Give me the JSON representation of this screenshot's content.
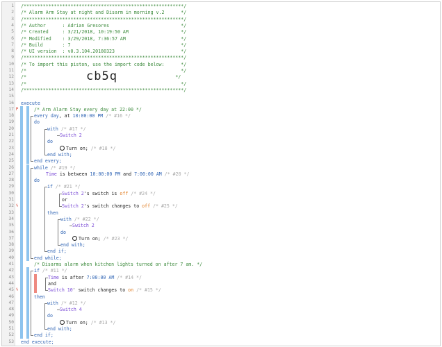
{
  "editor": {
    "lines": [
      {
        "n": "1",
        "segs": [
          {
            "c": "c",
            "t": "/**********************************************************/"
          }
        ]
      },
      {
        "n": "2",
        "segs": [
          {
            "c": "c",
            "t": "/* Alarm Arm Stay at night and Disarm in morning v.2      */"
          }
        ]
      },
      {
        "n": "3",
        "segs": [
          {
            "c": "c",
            "t": "/**********************************************************/"
          }
        ]
      },
      {
        "n": "4",
        "segs": [
          {
            "c": "c",
            "t": "/* Author      : Adrian Gresores                          */"
          }
        ]
      },
      {
        "n": "5",
        "segs": [
          {
            "c": "c",
            "t": "/* Created     : 3/21/2018, 10:19:50 AM                   */"
          }
        ]
      },
      {
        "n": "6",
        "segs": [
          {
            "c": "c",
            "t": "/* Modified    : 3/29/2018, 7:36:57 AM                    */"
          }
        ]
      },
      {
        "n": "7",
        "segs": [
          {
            "c": "c",
            "t": "/* Build       : 7                                        */"
          }
        ]
      },
      {
        "n": "8",
        "segs": [
          {
            "c": "c",
            "t": "/* UI version  : v0.3.104.20180323                        */"
          }
        ]
      },
      {
        "n": "9",
        "segs": [
          {
            "c": "c",
            "t": "/**********************************************************/"
          }
        ]
      },
      {
        "n": "10",
        "segs": [
          {
            "c": "c",
            "t": "/* To import this piston, use the import code below:      */"
          }
        ]
      },
      {
        "n": "11",
        "segs": [
          {
            "c": "c",
            "t": "/*                                                        */"
          }
        ]
      },
      {
        "n": "12",
        "segs": [
          {
            "c": "c",
            "t": "/*"
          },
          {
            "c": "c",
            "t": "                                                      */"
          }
        ]
      },
      {
        "n": "13",
        "segs": [
          {
            "c": "c",
            "t": "/*                                                        */"
          }
        ]
      },
      {
        "n": "14",
        "segs": [
          {
            "c": "c",
            "t": "/**********************************************************/"
          }
        ]
      },
      {
        "n": "15",
        "segs": []
      },
      {
        "n": "16",
        "segs": [
          {
            "c": "k",
            "t": "execute"
          }
        ]
      },
      {
        "n": "17",
        "segs": [
          {
            "c": "c",
            "t": "/* Arm Alarm Stay every day at 22:00 */"
          }
        ]
      },
      {
        "n": "18",
        "segs": [
          {
            "c": "k",
            "t": "every day"
          },
          {
            "c": "t",
            "t": ", at "
          },
          {
            "c": "k",
            "t": "10:00:00 PM"
          },
          {
            "c": "g",
            "t": " /* #16 */"
          }
        ]
      },
      {
        "n": "19",
        "segs": [
          {
            "c": "k",
            "t": "do"
          }
        ]
      },
      {
        "n": "20",
        "segs": [
          {
            "c": "k",
            "t": "with"
          },
          {
            "c": "g",
            "t": " /* #17 */"
          }
        ]
      },
      {
        "n": "21",
        "segs": [
          {
            "c": "d",
            "t": "Switch 2"
          }
        ]
      },
      {
        "n": "22",
        "segs": [
          {
            "c": "k",
            "t": "do"
          }
        ]
      },
      {
        "n": "23",
        "segs": [
          {
            "c": "t",
            "t": "Turn on;"
          },
          {
            "c": "g",
            "t": " /* #18 */"
          }
        ]
      },
      {
        "n": "24",
        "segs": [
          {
            "c": "k",
            "t": "end with;"
          }
        ]
      },
      {
        "n": "25",
        "segs": [
          {
            "c": "k",
            "t": "end every;"
          }
        ]
      },
      {
        "n": "26",
        "segs": [
          {
            "c": "k",
            "t": "while"
          },
          {
            "c": "g",
            "t": " /* #19 */"
          }
        ]
      },
      {
        "n": "27",
        "segs": [
          {
            "c": "d",
            "t": "Time"
          },
          {
            "c": "t",
            "t": " is between "
          },
          {
            "c": "k",
            "t": "10:00:00 PM"
          },
          {
            "c": "t",
            "t": " and "
          },
          {
            "c": "k",
            "t": "7:00:00 AM"
          },
          {
            "c": "g",
            "t": " /* #20 */"
          }
        ]
      },
      {
        "n": "28",
        "segs": [
          {
            "c": "k",
            "t": "do"
          }
        ]
      },
      {
        "n": "29",
        "segs": [
          {
            "c": "k",
            "t": "if"
          },
          {
            "c": "g",
            "t": " /* #21 */"
          }
        ]
      },
      {
        "n": "30",
        "segs": [
          {
            "c": "d",
            "t": "Switch 2"
          },
          {
            "c": "t",
            "t": "'s switch is "
          },
          {
            "c": "v",
            "t": "off"
          },
          {
            "c": "g",
            "t": " /* #24 */"
          }
        ]
      },
      {
        "n": "31",
        "segs": [
          {
            "c": "t",
            "t": "or"
          }
        ]
      },
      {
        "n": "32",
        "segs": [
          {
            "c": "d",
            "t": "Switch 2"
          },
          {
            "c": "t",
            "t": "'s switch changes to "
          },
          {
            "c": "v",
            "t": "off"
          },
          {
            "c": "g",
            "t": " /* #25 */"
          }
        ]
      },
      {
        "n": "33",
        "segs": [
          {
            "c": "k",
            "t": "then"
          }
        ]
      },
      {
        "n": "34",
        "segs": [
          {
            "c": "k",
            "t": "with"
          },
          {
            "c": "g",
            "t": " /* #22 */"
          }
        ]
      },
      {
        "n": "35",
        "segs": [
          {
            "c": "d",
            "t": "Switch 2"
          }
        ]
      },
      {
        "n": "36",
        "segs": [
          {
            "c": "k",
            "t": "do"
          }
        ]
      },
      {
        "n": "37",
        "segs": [
          {
            "c": "t",
            "t": "Turn on;"
          },
          {
            "c": "g",
            "t": " /* #23 */"
          }
        ]
      },
      {
        "n": "38",
        "segs": [
          {
            "c": "k",
            "t": "end with;"
          }
        ]
      },
      {
        "n": "39",
        "segs": [
          {
            "c": "k",
            "t": "end if;"
          }
        ]
      },
      {
        "n": "40",
        "segs": [
          {
            "c": "k",
            "t": "end while;"
          }
        ]
      },
      {
        "n": "41",
        "segs": [
          {
            "c": "c",
            "t": "/* Disarms alarm when kitchen lights turned on after 7 am. */"
          }
        ]
      },
      {
        "n": "42",
        "segs": [
          {
            "c": "k",
            "t": "if"
          },
          {
            "c": "g",
            "t": " /* #11 */"
          }
        ]
      },
      {
        "n": "43",
        "segs": [
          {
            "c": "d",
            "t": "Time"
          },
          {
            "c": "t",
            "t": " is after "
          },
          {
            "c": "k",
            "t": "7:00:00 AM"
          },
          {
            "c": "g",
            "t": " /* #14 */"
          }
        ]
      },
      {
        "n": "44",
        "segs": [
          {
            "c": "t",
            "t": "and"
          }
        ]
      },
      {
        "n": "45",
        "segs": [
          {
            "c": "d",
            "t": "Switch 10"
          },
          {
            "c": "t",
            "t": "' switch changes to "
          },
          {
            "c": "v",
            "t": "on"
          },
          {
            "c": "g",
            "t": " /* #15 */"
          }
        ]
      },
      {
        "n": "46",
        "segs": [
          {
            "c": "k",
            "t": "then"
          }
        ]
      },
      {
        "n": "47",
        "segs": [
          {
            "c": "k",
            "t": "with"
          },
          {
            "c": "g",
            "t": " /* #12 */"
          }
        ]
      },
      {
        "n": "48",
        "segs": [
          {
            "c": "d",
            "t": "Switch 4"
          }
        ]
      },
      {
        "n": "49",
        "segs": [
          {
            "c": "k",
            "t": "do"
          }
        ]
      },
      {
        "n": "50",
        "segs": [
          {
            "c": "t",
            "t": "Turn on;"
          },
          {
            "c": "g",
            "t": " /* #13 */"
          }
        ]
      },
      {
        "n": "51",
        "segs": [
          {
            "c": "k",
            "t": "end with;"
          }
        ]
      },
      {
        "n": "52",
        "segs": [
          {
            "c": "k",
            "t": "end if;"
          }
        ]
      },
      {
        "n": "53",
        "segs": [
          {
            "c": "k",
            "t": "end execute;"
          }
        ]
      }
    ],
    "import_code": "cb5q",
    "markers": {
      "17": "P",
      "32": "ϟ",
      "45": "ϟ"
    },
    "colors": {
      "comment": "#3c8a3c",
      "keyword": "#2f64b4",
      "device": "#7a4bd6",
      "value": "#e07b1f",
      "trigger": "#d84a3a",
      "bar_blue": "#8ec4ee",
      "bar_red": "#ee8a80"
    }
  }
}
